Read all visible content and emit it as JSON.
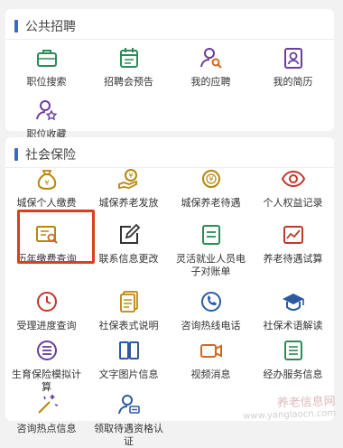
{
  "section_a": {
    "title": "公共招聘",
    "items": [
      {
        "label": "职位搜索",
        "icon": "briefcase-icon"
      },
      {
        "label": "招聘会预告",
        "icon": "calendar-icon"
      },
      {
        "label": "我的应聘",
        "icon": "user-search-icon"
      },
      {
        "label": "我的简历",
        "icon": "resume-icon"
      },
      {
        "label": "职位收藏",
        "icon": "user-star-icon"
      }
    ]
  },
  "section_b": {
    "title": "社会保险",
    "items": [
      {
        "label": "城保个人缴费",
        "icon": "money-bag-icon"
      },
      {
        "label": "城保养老发放",
        "icon": "yen-hand-icon"
      },
      {
        "label": "城保养老待遇",
        "icon": "yen-coin-icon"
      },
      {
        "label": "个人权益记录",
        "icon": "eye-icon"
      },
      {
        "label": "历年缴费查询",
        "icon": "record-search-icon"
      },
      {
        "label": "联系信息更改",
        "icon": "edit-icon"
      },
      {
        "label": "灵活就业人员电子对账单",
        "icon": "bill-icon"
      },
      {
        "label": "养老待遇试算",
        "icon": "chart-icon"
      },
      {
        "label": "受理进度查询",
        "icon": "clock-icon"
      },
      {
        "label": "社保表式说明",
        "icon": "document-icon"
      },
      {
        "label": "咨询热线电话",
        "icon": "phone-icon"
      },
      {
        "label": "社保术语解读",
        "icon": "graduation-cap-icon"
      },
      {
        "label": "生育保险模拟计算",
        "icon": "list-circle-icon"
      },
      {
        "label": "文字图片信息",
        "icon": "book-icon"
      },
      {
        "label": "视频消息",
        "icon": "video-icon"
      },
      {
        "label": "经办服务信息",
        "icon": "list-icon"
      },
      {
        "label": "咨询热点信息",
        "icon": "sparkle-icon"
      },
      {
        "label": "领取待遇资格认证",
        "icon": "user-verify-icon"
      }
    ]
  },
  "watermark": {
    "line1": "养老信息网",
    "line2": "www.yanglaocn.com"
  },
  "colors": {
    "section_bar": "#3a68c4",
    "highlight": "#d9401b",
    "green": "#2e8b57",
    "purple": "#6a3f99",
    "gold": "#b8860b",
    "orange": "#d2691e",
    "red": "#c0392b",
    "blue": "#2c5aa0"
  }
}
